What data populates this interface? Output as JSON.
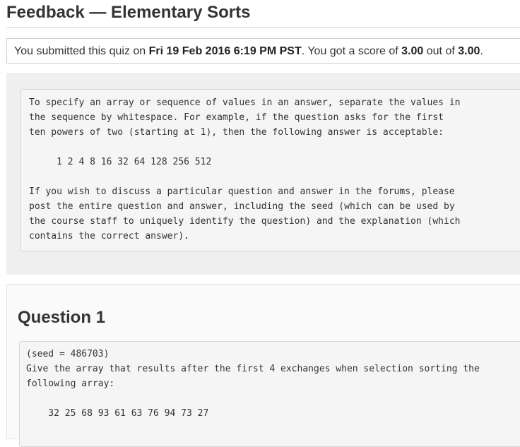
{
  "page": {
    "title": "Feedback — Elementary Sorts"
  },
  "score": {
    "prefix": "You submitted this quiz on ",
    "date": "Fri 19 Feb 2016 6:19 PM PST",
    "middle": ". You got a score of ",
    "score": "3.00",
    "out_of_text": " out of ",
    "max": "3.00",
    "suffix": "."
  },
  "instructions": {
    "lines": [
      "To specify an array or sequence of values in an answer, separate the values in",
      "the sequence by whitespace. For example, if the question asks for the first",
      "ten powers of two (starting at 1), then the following answer is acceptable:",
      "     1 2 4 8 16 32 64 128 256 512",
      "If you wish to discuss a particular question and answer in the forums, please",
      "post the entire question and answer, including the seed (which can be used by",
      "the course staff to uniquely identify the question) and the explanation (which",
      "contains the correct answer)."
    ]
  },
  "question": {
    "heading": "Question 1",
    "seed_line": "(seed = 486703)",
    "prompt_line1": "Give the array that results after the first 4 exchanges when selection sorting the",
    "prompt_line2": "following array:",
    "array_line": "    32 25 68 93 61 63 76 94 73 27"
  }
}
